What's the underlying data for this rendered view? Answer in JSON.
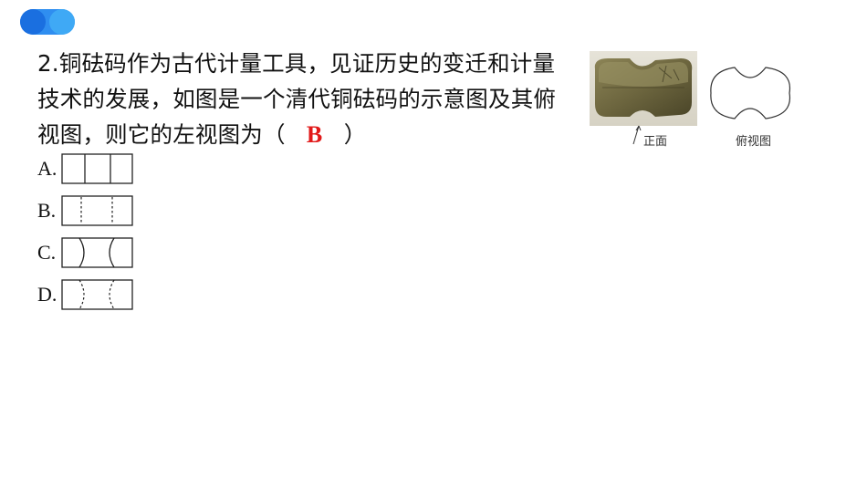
{
  "question": {
    "number": "2.",
    "text_before_answer": "铜砝码作为古代计量工具，见证历史的变迁和计量技术的发展，如图是一个清代铜砝码的示意图及其俯视图，则它的左视图为（",
    "answer": "B",
    "text_after_answer": "）"
  },
  "options": [
    {
      "label": "A.",
      "figure": "rectangle-two-solid-vertical-lines"
    },
    {
      "label": "B.",
      "figure": "rectangle-two-dashed-vertical-lines"
    },
    {
      "label": "C.",
      "figure": "rectangle-two-solid-arcs"
    },
    {
      "label": "D.",
      "figure": "rectangle-two-dashed-arcs"
    }
  ],
  "figure": {
    "front_caption": "正面",
    "top_view_caption": "俯视图"
  },
  "colors": {
    "answer": "#e21a1a",
    "logo_dark": "#1a6fe0",
    "logo_light": "#3fa9f5"
  }
}
